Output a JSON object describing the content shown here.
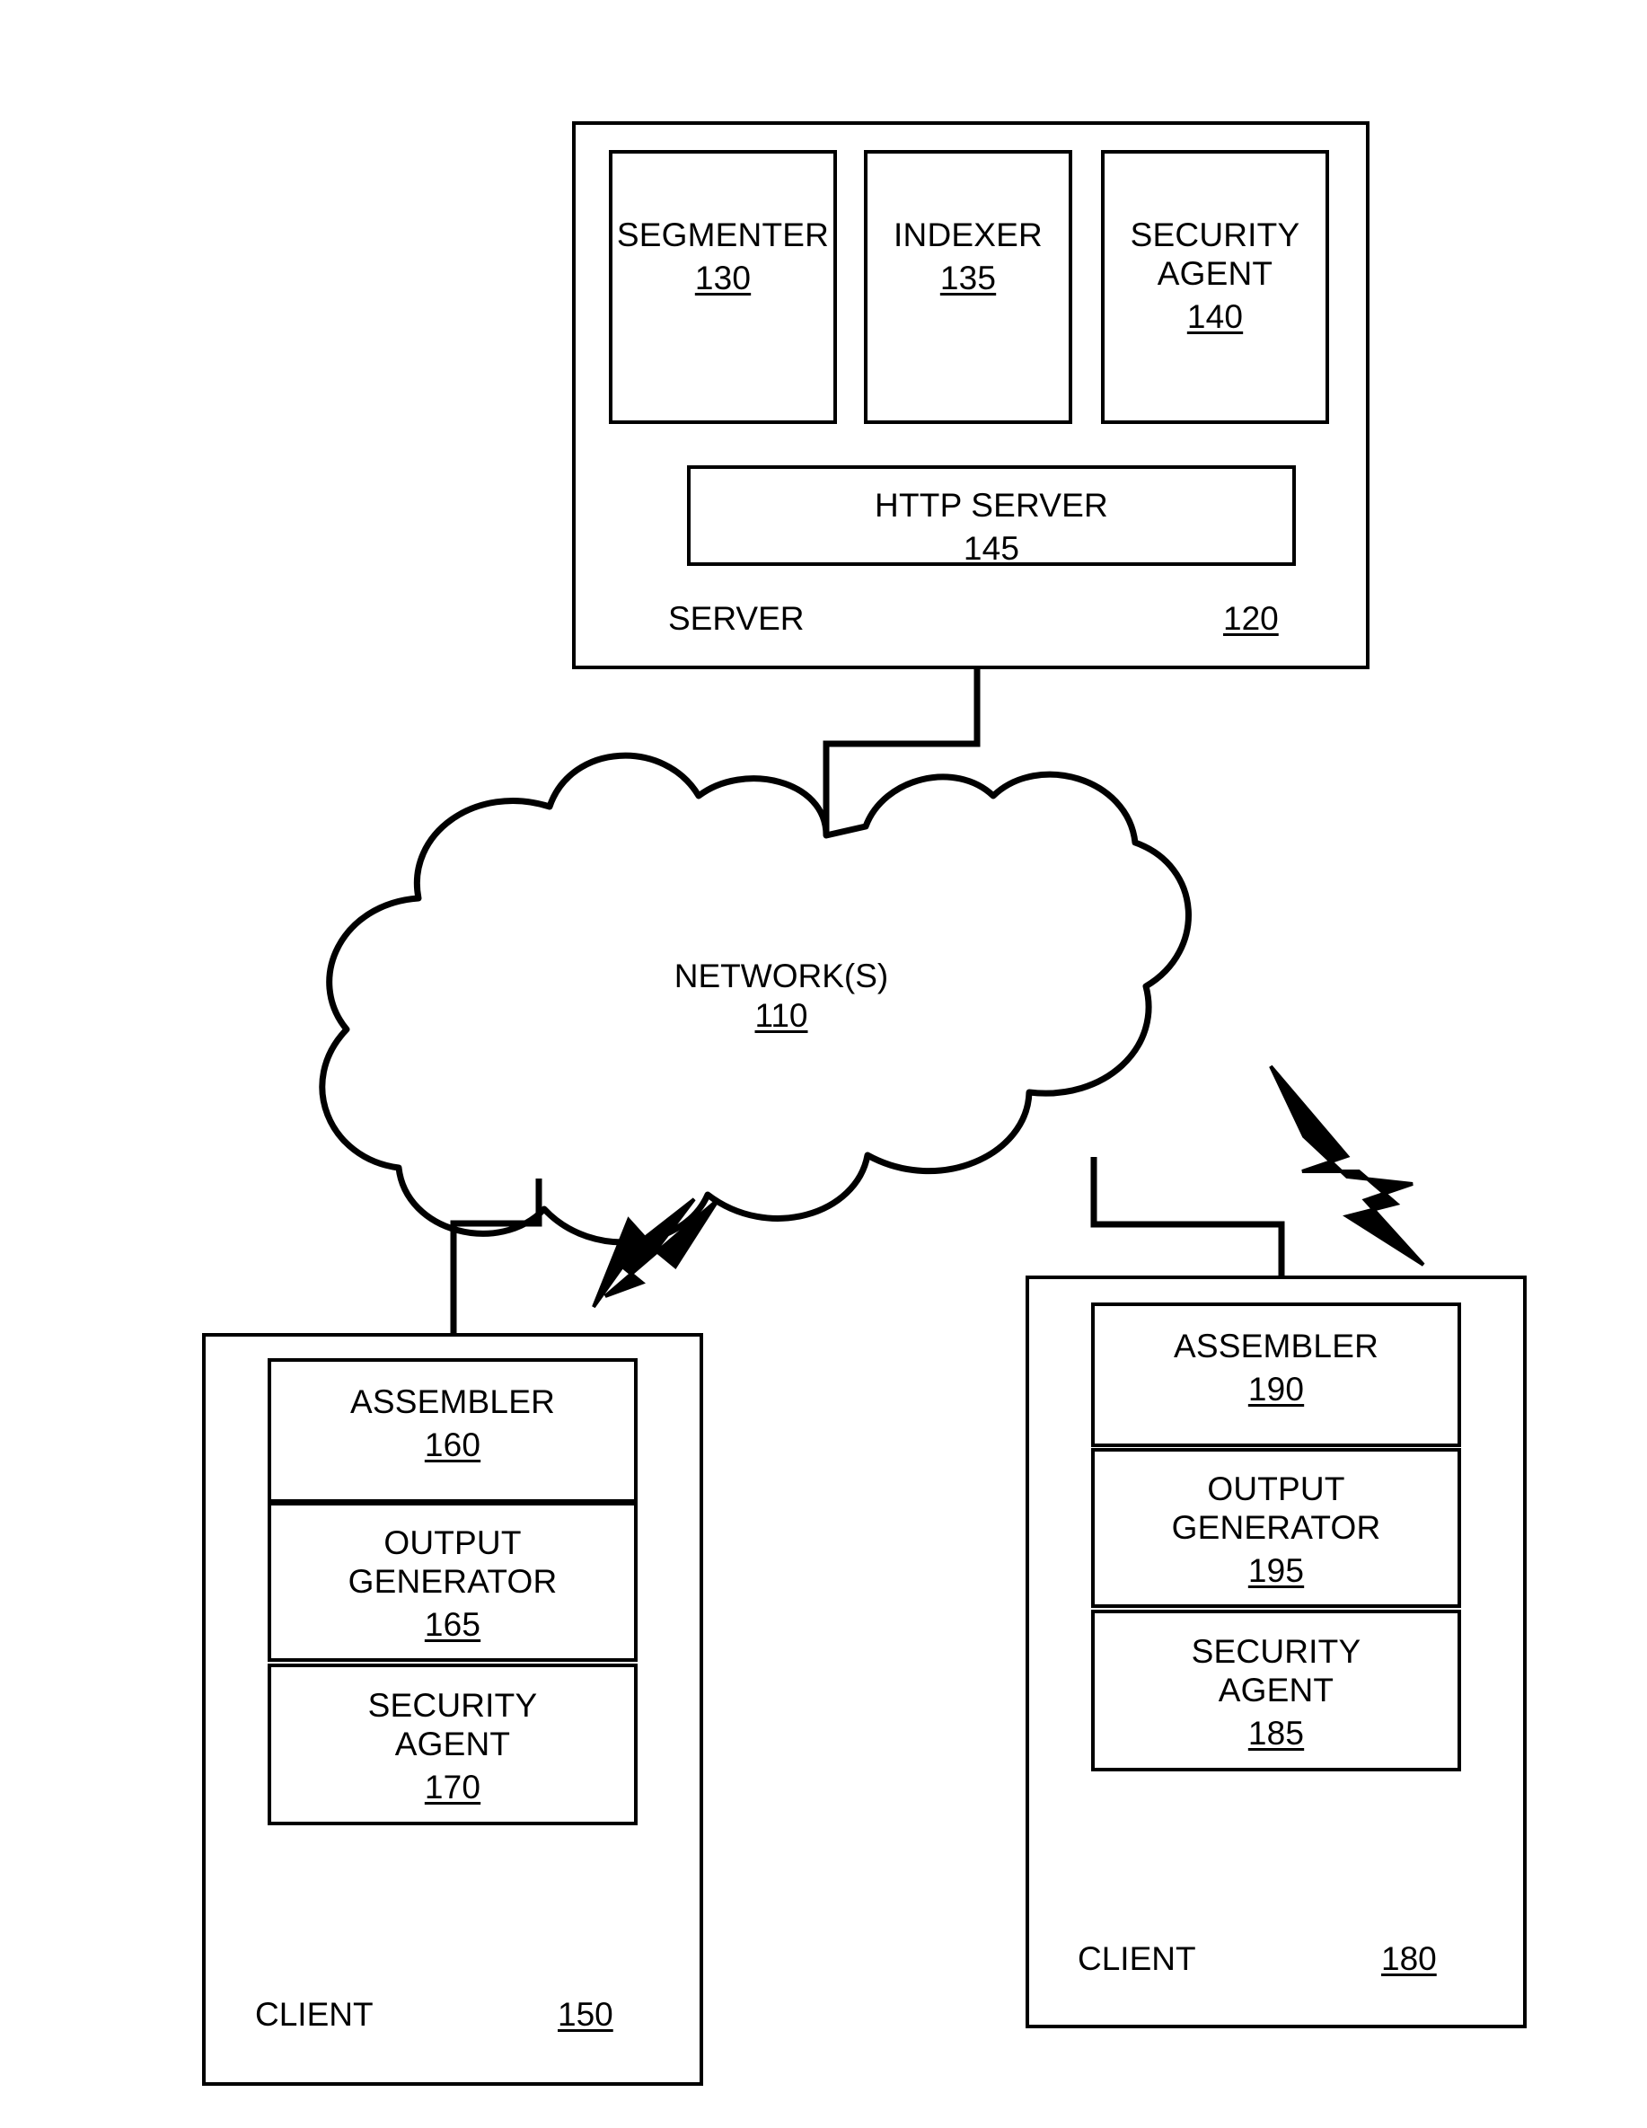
{
  "figure": {
    "type": "patent-system-architecture-diagram",
    "background_color": "#ffffff",
    "line_color": "#000000"
  },
  "server": {
    "name": "server-container",
    "footer_label": "SERVER",
    "reference_numeral": "120",
    "modules": [
      {
        "name": "segmenter",
        "label": "SEGMENTER",
        "reference_numeral": "130"
      },
      {
        "name": "indexer",
        "label": "INDEXER",
        "reference_numeral": "135"
      },
      {
        "name": "security-agent",
        "label_line1": "SECURITY",
        "label_line2": "AGENT",
        "reference_numeral": "140"
      }
    ],
    "http_server": {
      "label": "HTTP SERVER",
      "reference_numeral": "145"
    }
  },
  "network": {
    "label": "NETWORK(S)",
    "reference_numeral": "110"
  },
  "client_left": {
    "name": "client-150",
    "footer_label": "CLIENT",
    "reference_numeral": "150",
    "modules": [
      {
        "name": "assembler",
        "label": "ASSEMBLER",
        "reference_numeral": "160"
      },
      {
        "name": "output-generator",
        "label_line1": "OUTPUT",
        "label_line2": "GENERATOR",
        "reference_numeral": "165"
      },
      {
        "name": "security-agent",
        "label_line1": "SECURITY",
        "label_line2": "AGENT",
        "reference_numeral": "170"
      }
    ]
  },
  "client_right": {
    "name": "client-180",
    "footer_label": "CLIENT",
    "reference_numeral": "180",
    "modules": [
      {
        "name": "assembler",
        "label": "ASSEMBLER",
        "reference_numeral": "190"
      },
      {
        "name": "output-generator",
        "label_line1": "OUTPUT",
        "label_line2": "GENERATOR",
        "reference_numeral": "195"
      },
      {
        "name": "security-agent",
        "label_line1": "SECURITY",
        "label_line2": "AGENT",
        "reference_numeral": "185"
      }
    ]
  },
  "connectors": [
    {
      "name": "server-to-network",
      "style": "solid-orthogonal"
    },
    {
      "name": "network-to-client-150",
      "style": "solid-orthogonal"
    },
    {
      "name": "network-to-client-180",
      "style": "solid-orthogonal"
    },
    {
      "name": "wireless-link-left",
      "style": "lightning-bolt"
    },
    {
      "name": "wireless-link-right",
      "style": "lightning-bolt"
    }
  ]
}
